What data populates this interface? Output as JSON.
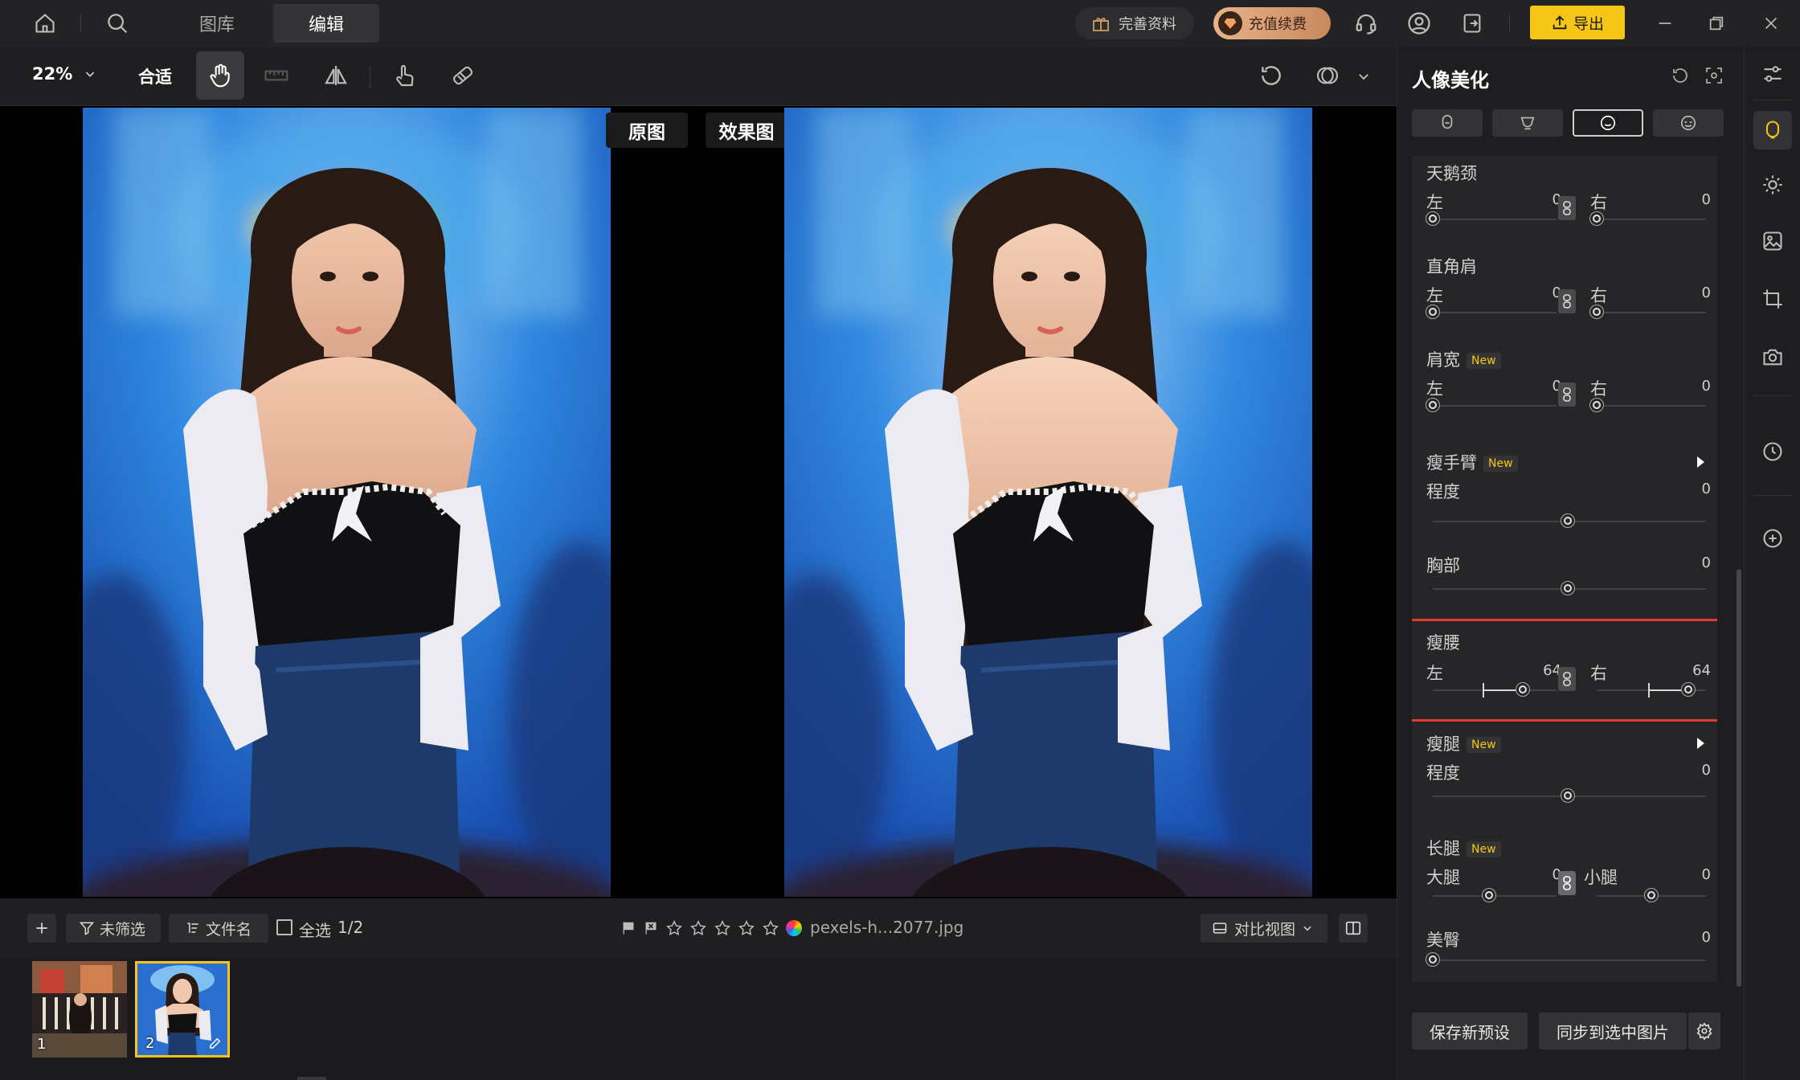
{
  "tabs": {
    "library": "图库",
    "edit": "编辑"
  },
  "header": {
    "complete_profile": "完善资料",
    "recharge": "充值续费",
    "export": "导出"
  },
  "toolbar": {
    "zoom": "22%",
    "fit": "合适"
  },
  "canvas": {
    "original_label": "原图",
    "effect_label": "效果图"
  },
  "filmbar": {
    "filter": "未筛选",
    "sort": "文件名",
    "select_all": "全选",
    "count": "1/2",
    "filename": "pexels-h...2077.jpg",
    "view_mode": "对比视图"
  },
  "thumbs": [
    {
      "index": "1"
    },
    {
      "index": "2"
    }
  ],
  "panel": {
    "title": "人像美化",
    "sections": {
      "swan_neck": {
        "title": "天鹅颈",
        "left": "左",
        "left_val": "0",
        "right": "右",
        "right_val": "0"
      },
      "straight_shoulder": {
        "title": "直角肩",
        "left": "左",
        "left_val": "0",
        "right": "右",
        "right_val": "0"
      },
      "shoulder_width": {
        "title": "肩宽",
        "badge": "New",
        "left": "左",
        "left_val": "0",
        "right": "右",
        "right_val": "0"
      },
      "slim_arm": {
        "title": "瘦手臂",
        "badge": "New",
        "degree": "程度",
        "value": "0"
      },
      "chest": {
        "title": "胸部",
        "value": "0"
      },
      "slim_waist": {
        "title": "瘦腰",
        "left": "左",
        "left_val": "64",
        "right": "右",
        "right_val": "64"
      },
      "slim_leg": {
        "title": "瘦腿",
        "badge": "New",
        "degree": "程度",
        "value": "0"
      },
      "long_leg": {
        "title": "长腿",
        "badge": "New",
        "thigh": "大腿",
        "thigh_val": "0",
        "calf": "小腿",
        "calf_val": "0"
      },
      "hip": {
        "title": "美臀",
        "value": "0"
      }
    },
    "save_preset": "保存新预设",
    "sync": "同步到选中图片"
  },
  "colors": {
    "accent": "#f5c518",
    "highlight": "#e0392e"
  }
}
